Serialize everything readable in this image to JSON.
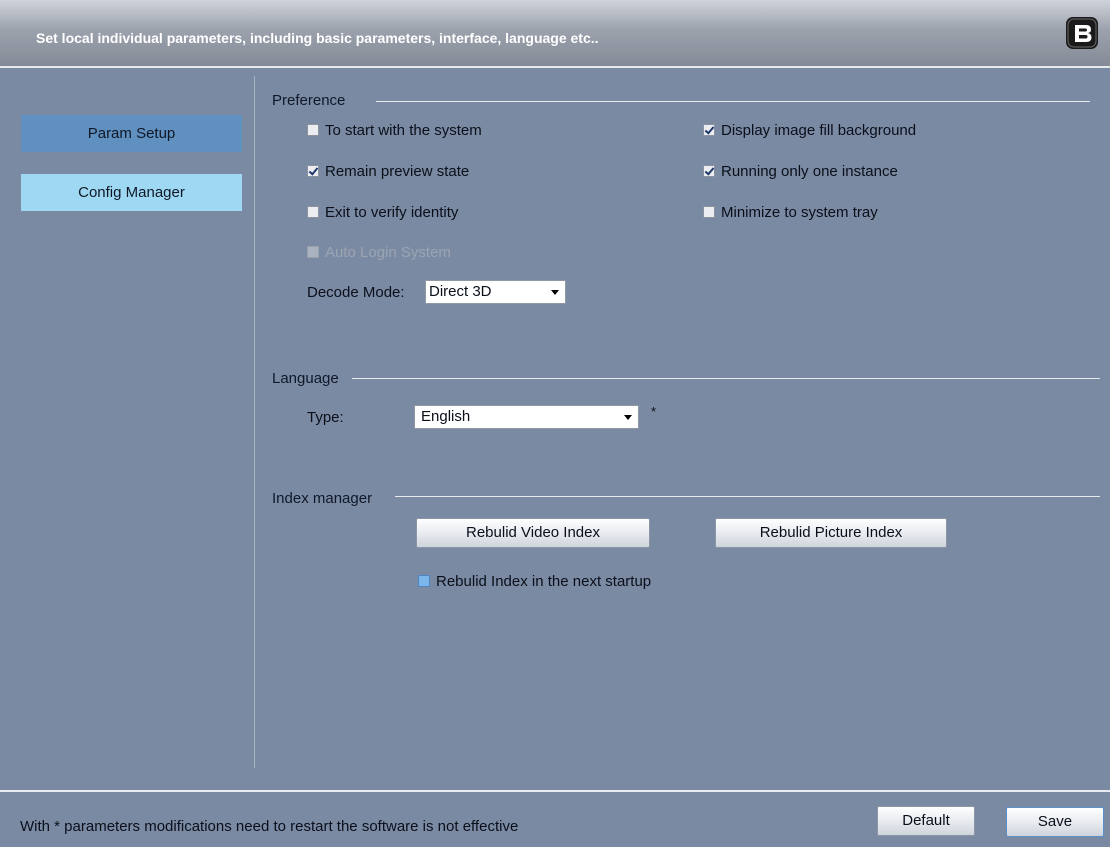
{
  "header": {
    "title": "Set local individual parameters, including basic parameters, interface, language etc..",
    "logo_letter": "B"
  },
  "sidebar": {
    "items": [
      {
        "label": "Param Setup",
        "active": true
      },
      {
        "label": "Config Manager",
        "active": false
      }
    ]
  },
  "preference": {
    "title": "Preference",
    "left_options": [
      {
        "label": "To start with the system",
        "checked": false
      },
      {
        "label": "Remain preview state",
        "checked": true
      },
      {
        "label": "Exit to verify identity",
        "checked": false
      },
      {
        "label": "Auto Login System",
        "checked": false,
        "disabled": true
      }
    ],
    "right_options": [
      {
        "label": "Display image fill background",
        "checked": true
      },
      {
        "label": "Running only one instance",
        "checked": true
      },
      {
        "label": "Minimize to system tray",
        "checked": false
      }
    ],
    "decode_mode": {
      "label": "Decode Mode:",
      "value": "Direct 3D"
    }
  },
  "language": {
    "title": "Language",
    "type_label": "Type:",
    "value": "English",
    "restart_mark": "*"
  },
  "index_manager": {
    "title": "Index manager",
    "rebuild_video_label": "Rebulid Video Index",
    "rebuild_picture_label": "Rebulid Picture Index",
    "rebuild_next_startup_label": "Rebulid Index in the next startup"
  },
  "footer": {
    "note": "With * parameters modifications need to restart the software is not effective",
    "default_label": "Default",
    "save_label": "Save"
  }
}
